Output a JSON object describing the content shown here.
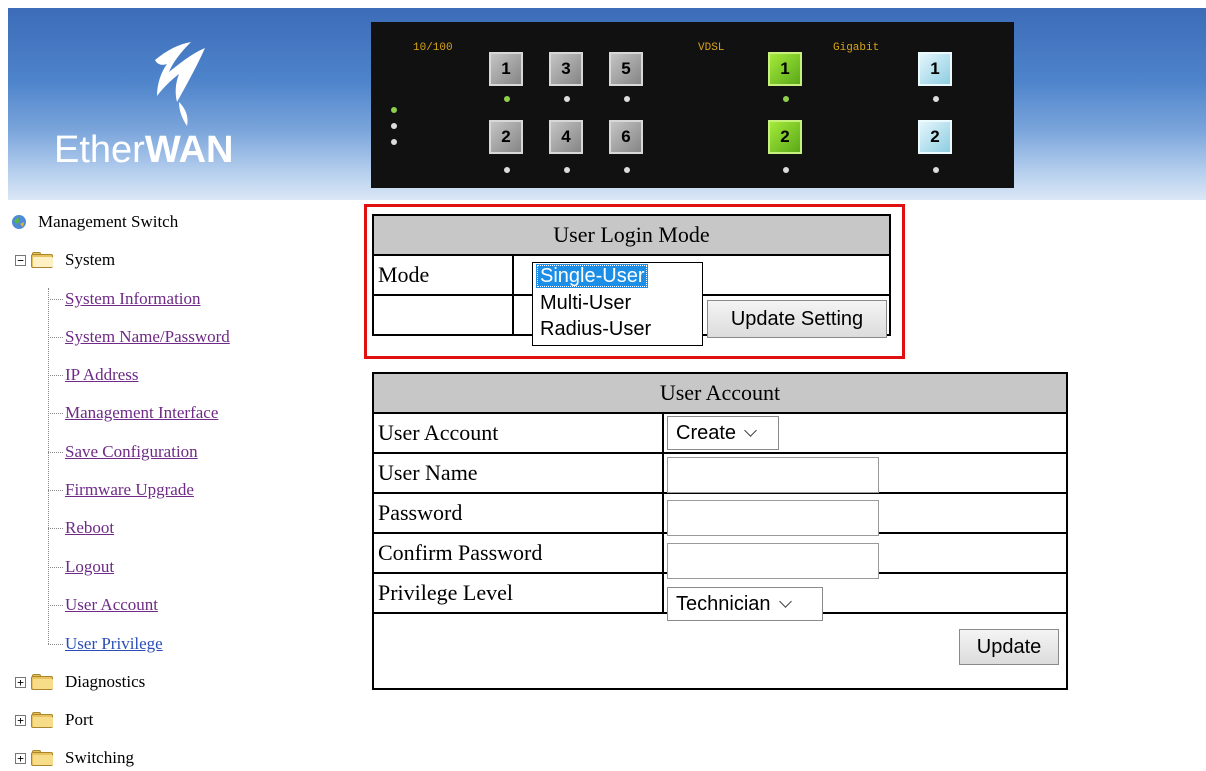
{
  "header": {
    "logo_text_part1": "Ether",
    "logo_text_part2": "WAN",
    "panel": {
      "label_fast": "10/100",
      "label_vdsl": "VDSL",
      "label_gigabit": "Gigabit",
      "fast_ports": [
        "1",
        "3",
        "5",
        "2",
        "4",
        "6"
      ],
      "vdsl_ports": [
        "1",
        "2"
      ],
      "gigabit_ports": [
        "1",
        "2"
      ]
    }
  },
  "sidebar": {
    "root": "Management Switch",
    "system": "System",
    "items": [
      "System Information",
      "System Name/Password",
      "IP Address",
      "Management Interface",
      "Save Configuration",
      "Firmware Upgrade",
      "Reboot",
      "Logout",
      "User Account",
      "User Privilege"
    ],
    "collapsed_folders": [
      "Diagnostics",
      "Port",
      "Switching"
    ]
  },
  "login_mode": {
    "title": "User Login Mode",
    "mode_label": "Mode",
    "options": [
      "Single-User",
      "Multi-User",
      "Radius-User"
    ],
    "selected": "Single-User",
    "update_button": "Update Setting"
  },
  "user_account": {
    "title": "User Account",
    "rows": {
      "account_label": "User Account",
      "account_value": "Create",
      "name_label": "User Name",
      "password_label": "Password",
      "confirm_label": "Confirm Password",
      "privilege_label": "Privilege Level",
      "privilege_value": "Technician"
    },
    "update_button": "Update"
  },
  "colors": {
    "highlight_border": "#e01010",
    "selected_option": "#1c8ee6",
    "link_visited": "#6e2a86",
    "link_active": "#2a4db8"
  }
}
